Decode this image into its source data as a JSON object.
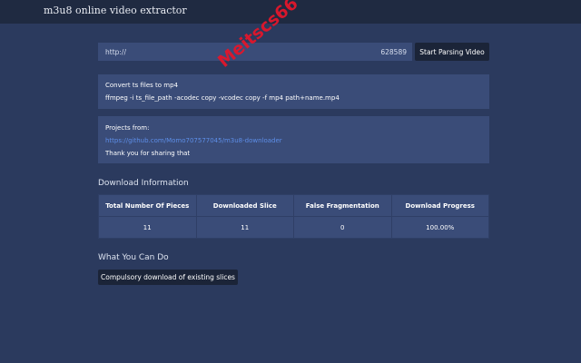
{
  "app": {
    "title": "m3u8 online video extractor"
  },
  "parser": {
    "url_value": "http://",
    "url_tail": "628589",
    "button_label": "Start Parsing Video"
  },
  "convert_card": {
    "title": "Convert ts files to mp4",
    "command": "ffmpeg -i ts_file_path -acodec copy -vcodec copy -f mp4 path+name.mp4"
  },
  "projects_card": {
    "label": "Projects from:",
    "link": "https://github.com/Momo707577045/m3u8-downloader",
    "thanks": "Thank you for sharing that"
  },
  "download_info": {
    "heading": "Download Information",
    "columns": [
      "Total Number Of Pieces",
      "Downloaded Slice",
      "False Fragmentation",
      "Download Progress"
    ],
    "values": [
      "11",
      "11",
      "0",
      "100.00%"
    ]
  },
  "actions": {
    "heading": "What You Can Do",
    "force_button": "Compulsory download of existing slices"
  },
  "watermark": {
    "text": "Meitscs66"
  },
  "colors": {
    "background": "#2b3a5e",
    "topbar": "#1f2a41",
    "card": "#3a4c78",
    "button": "#1b2438",
    "link": "#5d8ee8",
    "watermark": "#e2162b"
  }
}
